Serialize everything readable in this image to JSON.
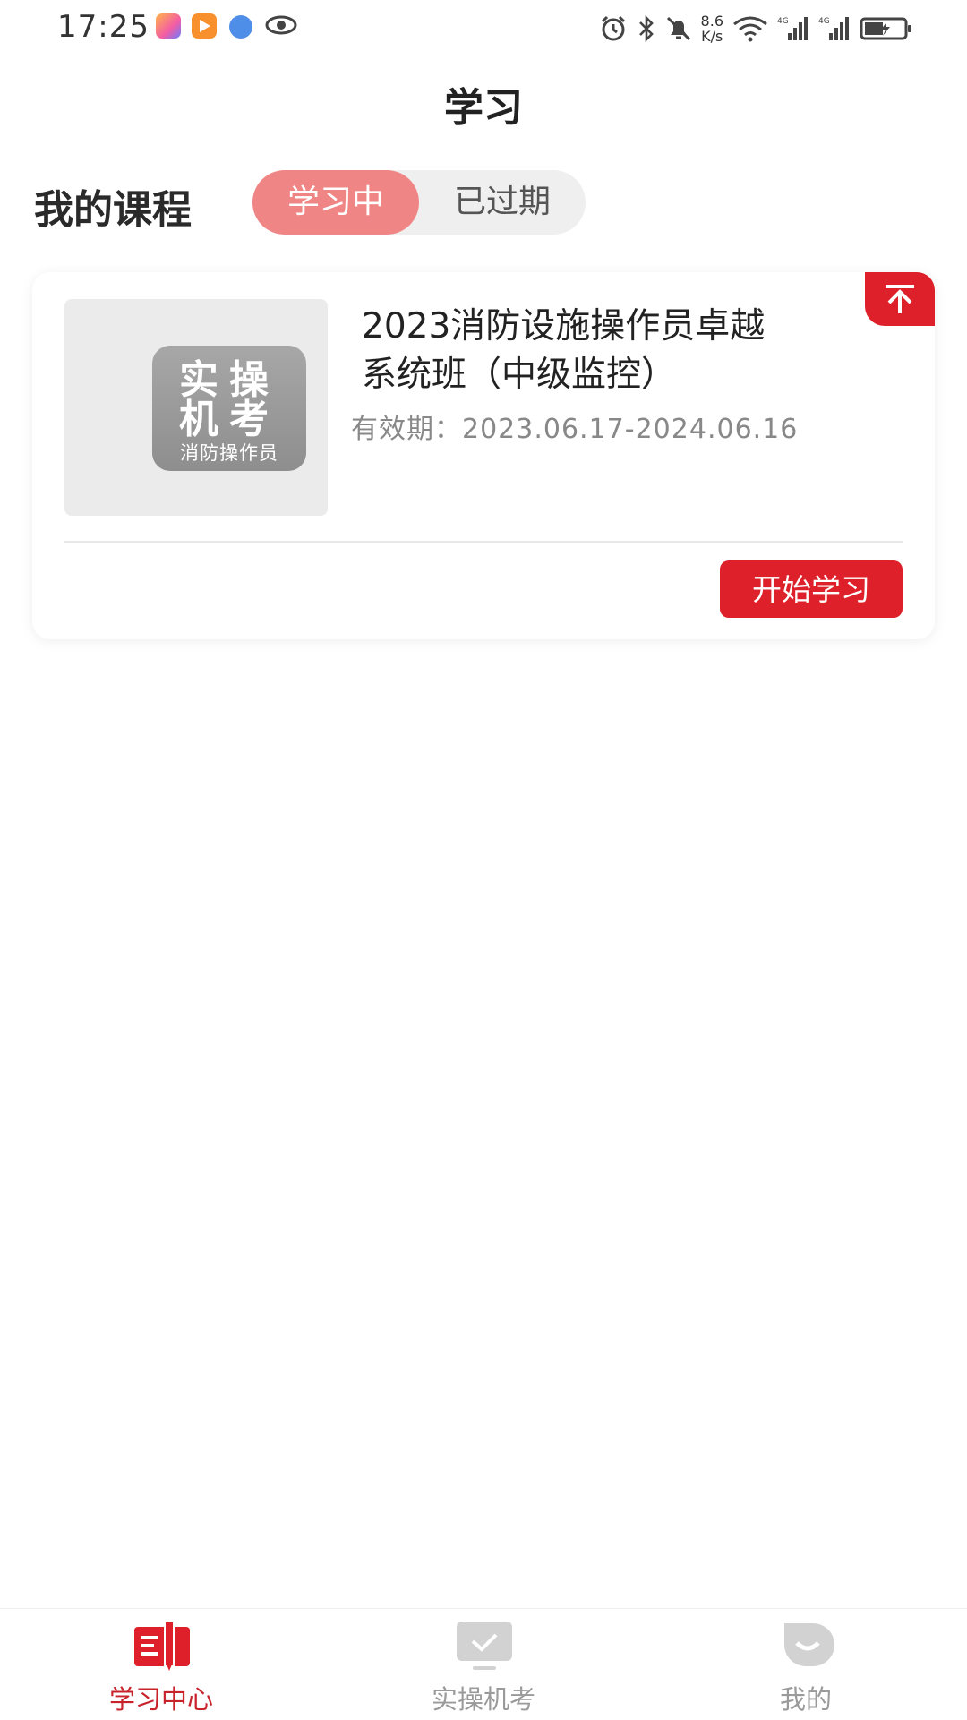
{
  "status_bar": {
    "time": "17:25",
    "net_speed_value": "8.6",
    "net_speed_unit": "K/s",
    "signal_labels": [
      "4G",
      "4G"
    ],
    "icons": [
      "app-icon-1",
      "video-app-icon",
      "browser-app-icon",
      "eye-icon",
      "alarm-icon",
      "bluetooth-icon",
      "mute-icon",
      "wifi-icon",
      "signal-icon",
      "battery-charging-icon"
    ]
  },
  "header": {
    "title": "学习"
  },
  "courses": {
    "section_title": "我的课程",
    "tabs": [
      {
        "label": "学习中",
        "active": true
      },
      {
        "label": "已过期",
        "active": false
      }
    ]
  },
  "course_card": {
    "pinned": true,
    "thumbnail": {
      "line1": "实操",
      "line2": "机考",
      "line3": "消防操作员"
    },
    "title_line1": "2023消防设施操作员卓越",
    "title_line2": "系统班（中级监控）",
    "validity": "有效期：2023.06.17-2024.06.16",
    "button_label": "开始学习"
  },
  "tab_bar": {
    "items": [
      {
        "label": "学习中心",
        "icon": "book-icon",
        "active": true
      },
      {
        "label": "实操机考",
        "icon": "exam-monitor-icon",
        "active": false
      },
      {
        "label": "我的",
        "icon": "profile-icon",
        "active": false
      }
    ]
  },
  "colors": {
    "accent_red": "#dd202a",
    "active_tab_pink": "#f08585",
    "inactive_gray": "#9a9a9a"
  }
}
